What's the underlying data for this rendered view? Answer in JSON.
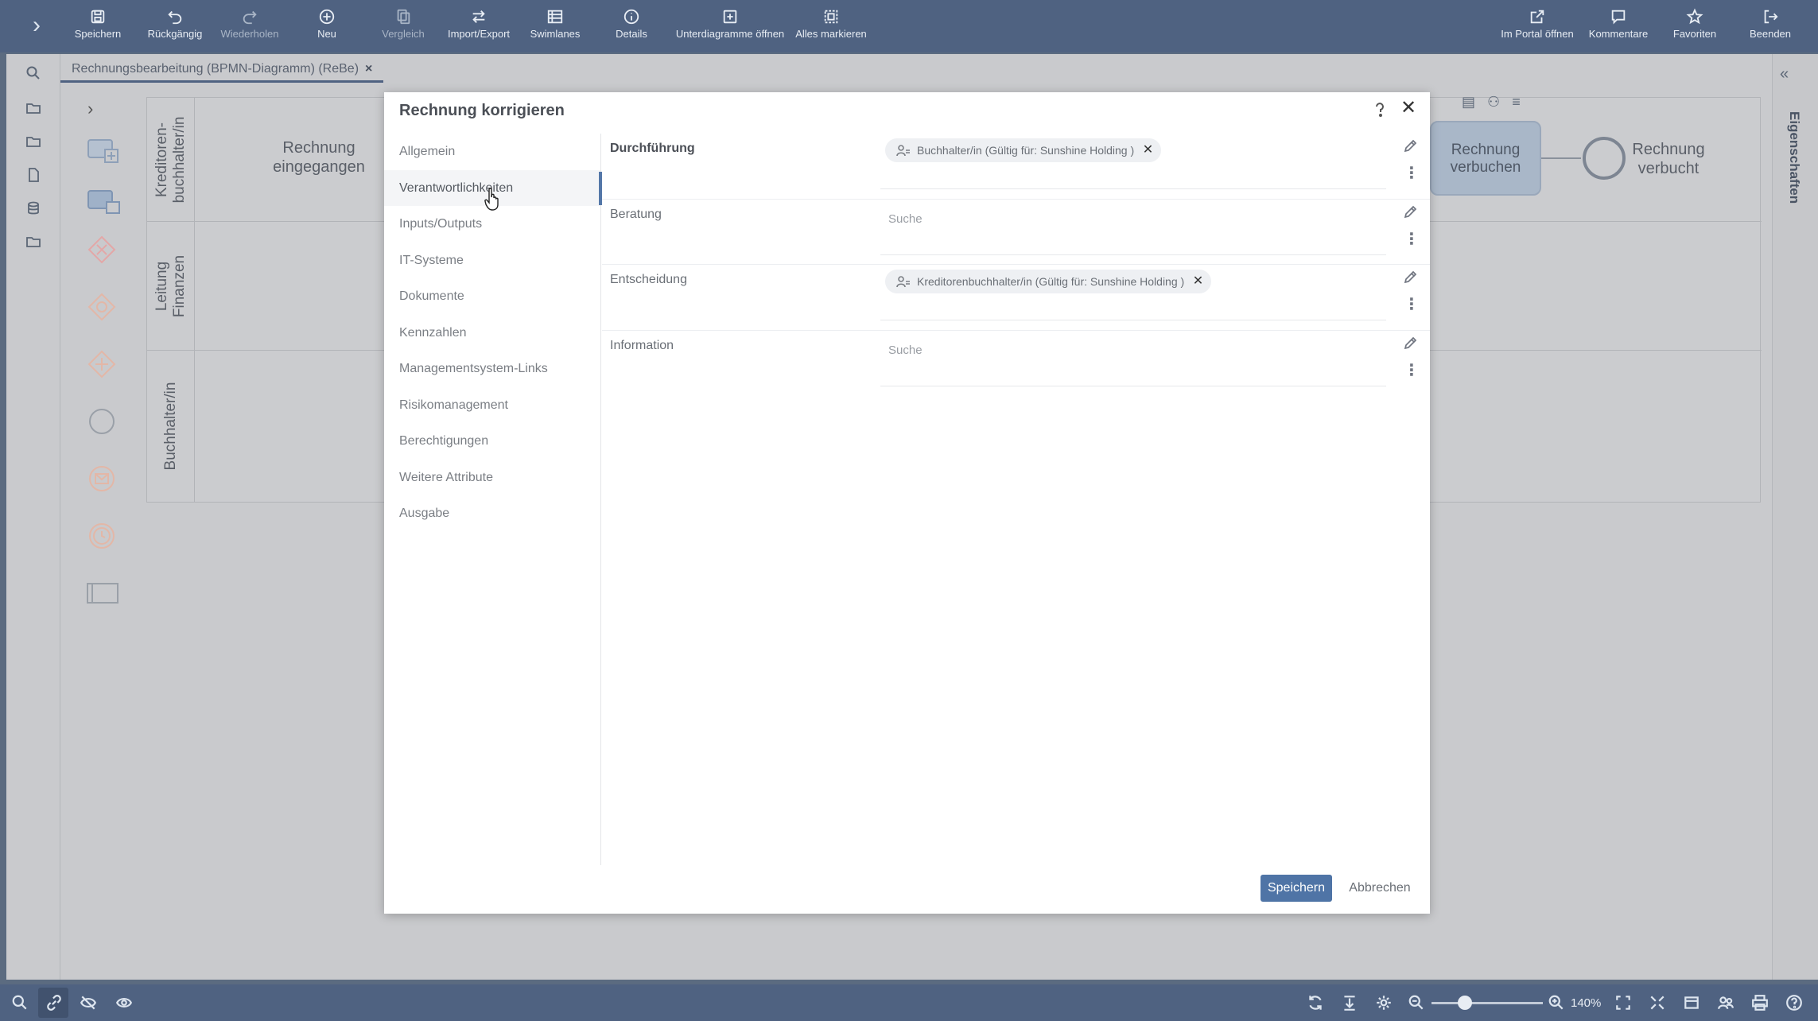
{
  "toolbar": {
    "buttons": [
      {
        "label": "Speichern",
        "icon": "save-icon"
      },
      {
        "label": "Rückgängig",
        "icon": "undo-icon"
      },
      {
        "label": "Wiederholen",
        "icon": "redo-icon"
      },
      {
        "label": "Neu",
        "icon": "plus-circle-icon"
      },
      {
        "label": "Vergleich",
        "icon": "compare-icon"
      },
      {
        "label": "Import/Export",
        "icon": "swap-icon"
      },
      {
        "label": "Swimlanes",
        "icon": "swimlanes-icon"
      },
      {
        "label": "Details",
        "icon": "info-icon"
      },
      {
        "label": "Unterdiagramme öffnen",
        "icon": "subdiagram-icon"
      },
      {
        "label": "Alles markieren",
        "icon": "select-all-icon"
      }
    ],
    "right_buttons": [
      {
        "label": "Im Portal öffnen",
        "icon": "external-link-icon"
      },
      {
        "label": "Kommentare",
        "icon": "comment-icon"
      },
      {
        "label": "Favoriten",
        "icon": "star-icon"
      },
      {
        "label": "Beenden",
        "icon": "exit-icon"
      }
    ]
  },
  "tab": {
    "title": "Rechnungsbearbeitung (BPMN-Diagramm) (ReBe)",
    "close": "×"
  },
  "right_panel": {
    "label": "Eigenschaften"
  },
  "diagram": {
    "lanes": [
      "Kreditoren-\nbuchhalter/in",
      "Leitung\nFinanzen",
      "Buchhalter/in"
    ],
    "start_event": "Rechnung\neingegangen",
    "task": "Rechnung\nverbuchen",
    "end_event": "Rechnung\nverbucht"
  },
  "modal": {
    "title": "Rechnung korrigieren",
    "menu": [
      "Allgemein",
      "Verantwortlichkeiten",
      "Inputs/Outputs",
      "IT-Systeme",
      "Dokumente",
      "Kennzahlen",
      "Managementsystem-Links",
      "Risikomanagement",
      "Berechtigungen",
      "Weitere Attribute",
      "Ausgabe"
    ],
    "active_menu_index": 1,
    "rows": [
      {
        "label": "Durchführung",
        "chip": "Buchhalter/in (Gültig für: Sunshine Holding )",
        "placeholder": ""
      },
      {
        "label": "Beratung",
        "chip": "",
        "placeholder": "Suche"
      },
      {
        "label": "Entscheidung",
        "chip": "Kreditorenbuchhalter/in (Gültig für: Sunshine Holding )",
        "placeholder": ""
      },
      {
        "label": "Information",
        "chip": "",
        "placeholder": "Suche"
      }
    ],
    "save_label": "Speichern",
    "cancel_label": "Abbrechen"
  },
  "bottombar": {
    "zoom": "140%",
    "zoom_fraction": 0.3
  },
  "colors": {
    "toolbar": "#4f6281",
    "accent": "#4f74a6"
  }
}
